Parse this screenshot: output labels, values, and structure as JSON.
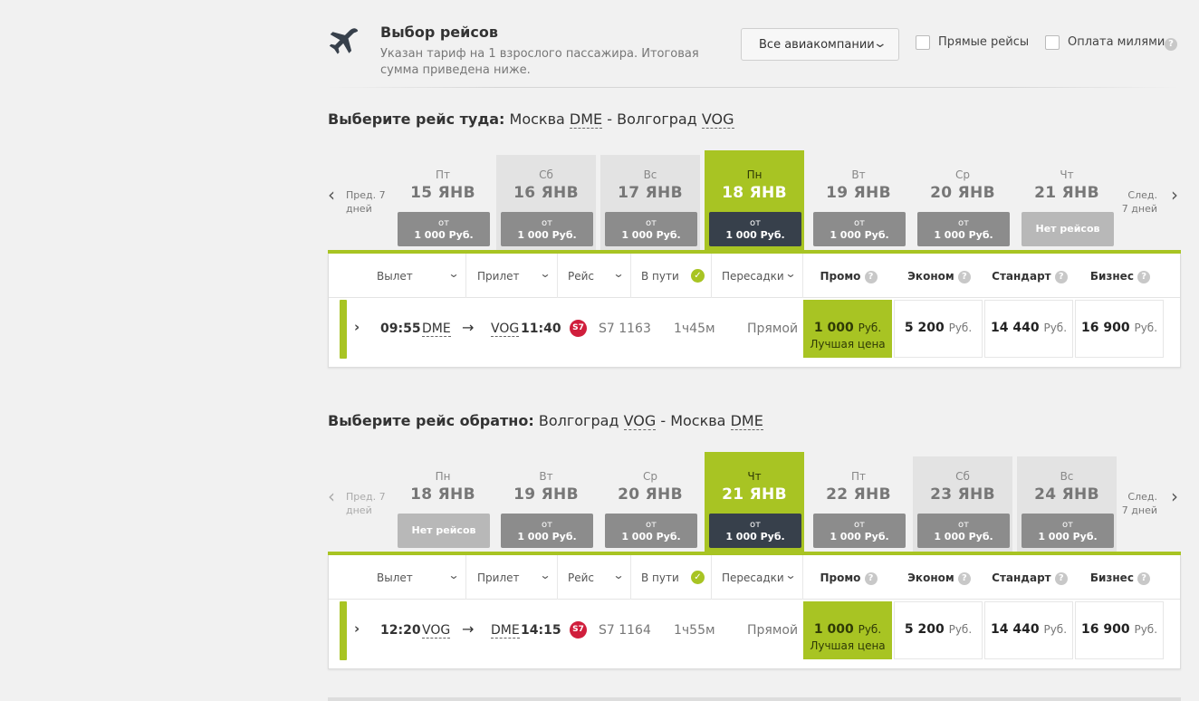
{
  "header": {
    "title": "Выбор рейсов",
    "subtitle": "Указан тариф на 1 взрослого пассажира. Итоговая сумма приведена ниже.",
    "airline_filter": "Все авиакомпании",
    "direct_label": "Прямые рейсы",
    "miles_label": "Оплата милями",
    "help": "?"
  },
  "nav": {
    "prev": "Пред. 7 дней",
    "next": "След. 7 дней"
  },
  "outbound": {
    "title_bold": "Выберите рейс туда:",
    "from_city": "Москва",
    "from_code": "DME",
    "sep": "-",
    "to_city": "Волгоград",
    "to_code": "VOG",
    "days": [
      {
        "dow": "Пт",
        "date": "15 ЯНВ",
        "ot": "от",
        "price": "1 000 Руб."
      },
      {
        "dow": "Сб",
        "date": "16 ЯНВ",
        "ot": "от",
        "price": "1 000 Руб."
      },
      {
        "dow": "Вс",
        "date": "17 ЯНВ",
        "ot": "от",
        "price": "1 000 Руб."
      },
      {
        "dow": "Пн",
        "date": "18 ЯНВ",
        "ot": "от",
        "price": "1 000 Руб."
      },
      {
        "dow": "Вт",
        "date": "19 ЯНВ",
        "ot": "от",
        "price": "1 000 Руб."
      },
      {
        "dow": "Ср",
        "date": "20 ЯНВ",
        "ot": "от",
        "price": "1 000 Руб."
      },
      {
        "dow": "Чт",
        "date": "21 ЯНВ",
        "none": "Нет рейсов"
      }
    ],
    "flight": {
      "dep_time": "09:55",
      "dep_code": "DME",
      "arrow": "→",
      "arr_code": "VOG",
      "arr_time": "11:40",
      "airline": "S7",
      "number": "S7 1163",
      "duration": "1ч45м",
      "stops": "Прямой",
      "promo": "1 000",
      "promo_tag": "Лучшая цена",
      "economy": "5 200",
      "standard": "14 440",
      "business": "16 900",
      "rub": "Руб."
    }
  },
  "inbound": {
    "title_bold": "Выберите рейс обратно:",
    "from_city": "Волгоград",
    "from_code": "VOG",
    "sep": "-",
    "to_city": "Москва",
    "to_code": "DME",
    "days": [
      {
        "dow": "Пн",
        "date": "18 ЯНВ",
        "none": "Нет рейсов"
      },
      {
        "dow": "Вт",
        "date": "19 ЯНВ",
        "ot": "от",
        "price": "1 000 Руб."
      },
      {
        "dow": "Ср",
        "date": "20 ЯНВ",
        "ot": "от",
        "price": "1 000 Руб."
      },
      {
        "dow": "Чт",
        "date": "21 ЯНВ",
        "ot": "от",
        "price": "1 000 Руб."
      },
      {
        "dow": "Пт",
        "date": "22 ЯНВ",
        "ot": "от",
        "price": "1 000 Руб."
      },
      {
        "dow": "Сб",
        "date": "23 ЯНВ",
        "ot": "от",
        "price": "1 000 Руб."
      },
      {
        "dow": "Вс",
        "date": "24 ЯНВ",
        "ot": "от",
        "price": "1 000 Руб."
      }
    ],
    "flight": {
      "dep_time": "12:20",
      "dep_code": "VOG",
      "arrow": "→",
      "arr_code": "DME",
      "arr_time": "14:15",
      "airline": "S7",
      "number": "S7 1164",
      "duration": "1ч55м",
      "stops": "Прямой",
      "promo": "1 000",
      "promo_tag": "Лучшая цена",
      "economy": "5 200",
      "standard": "14 440",
      "business": "16 900",
      "rub": "Руб."
    }
  },
  "columns": {
    "departure": "Вылет",
    "arrival": "Прилет",
    "flight": "Рейс",
    "duration": "В пути",
    "transfers": "Пересадки",
    "promo": "Промо",
    "economy": "Эконом",
    "standard": "Стандарт",
    "business": "Бизнес"
  },
  "icons": {
    "plane": "plane-icon",
    "chevron": "chevron-down-icon",
    "check": "check-icon",
    "expand": "chevron-right-icon",
    "help": "help-icon"
  },
  "colors": {
    "accent": "#a8c423",
    "dark": "#37404b",
    "price_btn": "#8c8c8c",
    "s7": "#d01e3c"
  }
}
